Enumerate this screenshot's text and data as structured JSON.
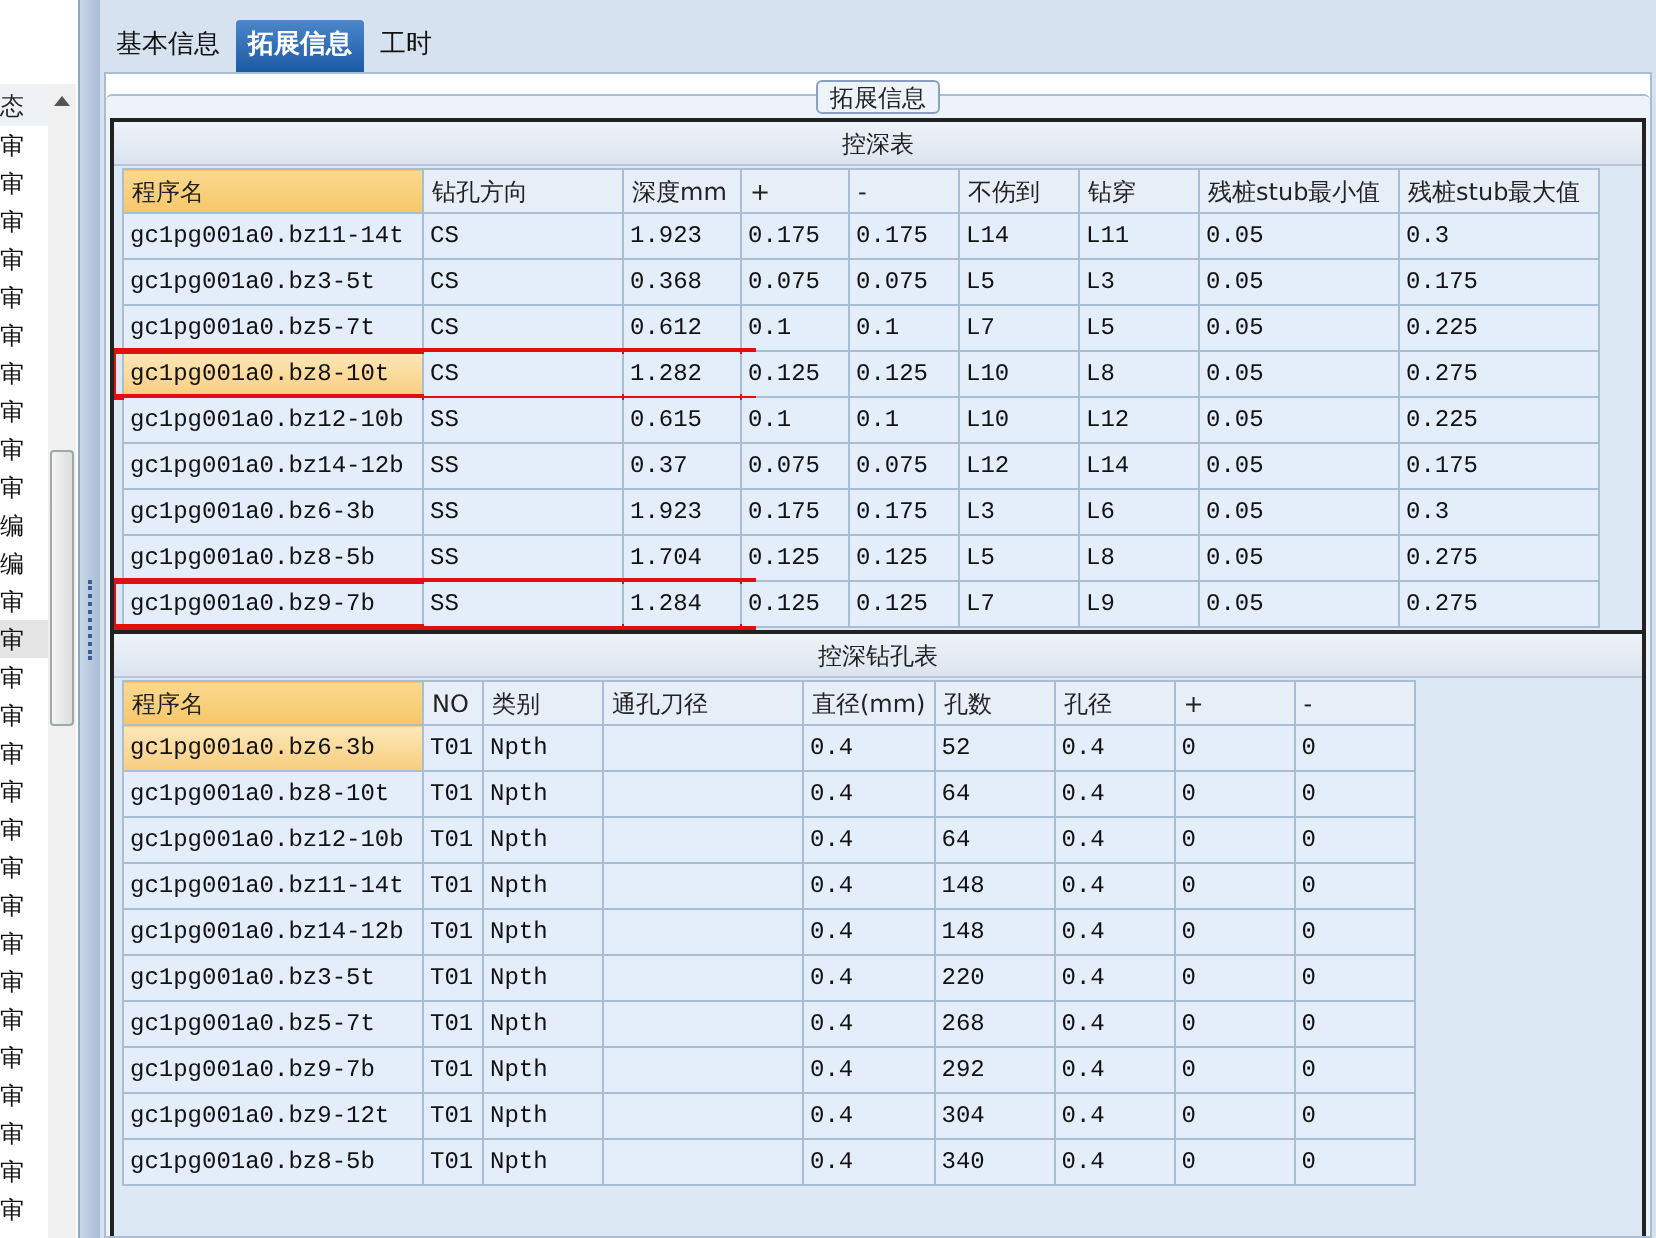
{
  "sidebar": {
    "header": "态",
    "items": [
      {
        "text": "审",
        "selected": false
      },
      {
        "text": "审",
        "selected": false
      },
      {
        "text": "审",
        "selected": false
      },
      {
        "text": "审",
        "selected": false
      },
      {
        "text": "审",
        "selected": false
      },
      {
        "text": "审",
        "selected": false
      },
      {
        "text": "审",
        "selected": false
      },
      {
        "text": "审",
        "selected": false
      },
      {
        "text": "审",
        "selected": false
      },
      {
        "text": "审",
        "selected": false
      },
      {
        "text": "编",
        "selected": false
      },
      {
        "text": "编",
        "selected": false
      },
      {
        "text": "审",
        "selected": false
      },
      {
        "text": "审",
        "selected": true
      },
      {
        "text": "审",
        "selected": false
      },
      {
        "text": "审",
        "selected": false
      },
      {
        "text": "审",
        "selected": false
      },
      {
        "text": "审",
        "selected": false
      },
      {
        "text": "审",
        "selected": false
      },
      {
        "text": "审",
        "selected": false
      },
      {
        "text": "审",
        "selected": false
      },
      {
        "text": "审",
        "selected": false
      },
      {
        "text": "审",
        "selected": false
      },
      {
        "text": "审",
        "selected": false
      },
      {
        "text": "审",
        "selected": false
      },
      {
        "text": "审",
        "selected": false
      },
      {
        "text": "审",
        "selected": false
      },
      {
        "text": "审",
        "selected": false
      },
      {
        "text": "审",
        "selected": false
      }
    ]
  },
  "tabs": [
    {
      "label": "基本信息",
      "selected": false
    },
    {
      "label": "拓展信息",
      "selected": true
    },
    {
      "label": "工时",
      "selected": false
    }
  ],
  "group_title": "拓展信息",
  "tables": [
    {
      "title": "控深表",
      "columns": [
        "程序名",
        "钻孔方向",
        "深度mm",
        "+",
        "-",
        "不伤到",
        "钻穿",
        "残桩stub最小值",
        "残桩stub最大值"
      ],
      "rows": [
        {
          "cells": [
            "gc1pg001a0.bz11-14t",
            "CS",
            "1.923",
            "0.175",
            "0.175",
            "L14",
            "L11",
            "0.05",
            "0.3"
          ],
          "selected": false,
          "highlighted": false
        },
        {
          "cells": [
            "gc1pg001a0.bz3-5t",
            "CS",
            "0.368",
            "0.075",
            "0.075",
            "L5",
            "L3",
            "0.05",
            "0.175"
          ],
          "selected": false,
          "highlighted": false
        },
        {
          "cells": [
            "gc1pg001a0.bz5-7t",
            "CS",
            "0.612",
            "0.1",
            "0.1",
            "L7",
            "L5",
            "0.05",
            "0.225"
          ],
          "selected": false,
          "highlighted": false
        },
        {
          "cells": [
            "gc1pg001a0.bz8-10t",
            "CS",
            "1.282",
            "0.125",
            "0.125",
            "L10",
            "L8",
            "0.05",
            "0.275"
          ],
          "selected": true,
          "highlighted": true
        },
        {
          "cells": [
            "gc1pg001a0.bz12-10b",
            "SS",
            "0.615",
            "0.1",
            "0.1",
            "L10",
            "L12",
            "0.05",
            "0.225"
          ],
          "selected": false,
          "highlighted": false
        },
        {
          "cells": [
            "gc1pg001a0.bz14-12b",
            "SS",
            "0.37",
            "0.075",
            "0.075",
            "L12",
            "L14",
            "0.05",
            "0.175"
          ],
          "selected": false,
          "highlighted": false
        },
        {
          "cells": [
            "gc1pg001a0.bz6-3b",
            "SS",
            "1.923",
            "0.175",
            "0.175",
            "L3",
            "L6",
            "0.05",
            "0.3"
          ],
          "selected": false,
          "highlighted": false
        },
        {
          "cells": [
            "gc1pg001a0.bz8-5b",
            "SS",
            "1.704",
            "0.125",
            "0.125",
            "L5",
            "L8",
            "0.05",
            "0.275"
          ],
          "selected": false,
          "highlighted": false
        },
        {
          "cells": [
            "gc1pg001a0.bz9-7b",
            "SS",
            "1.284",
            "0.125",
            "0.125",
            "L7",
            "L9",
            "0.05",
            "0.275"
          ],
          "selected": false,
          "highlighted": true
        }
      ]
    },
    {
      "title": "控深钻孔表",
      "columns": [
        "程序名",
        "NO",
        "类别",
        "通孔刀径",
        "直径(mm)",
        "孔数",
        "孔径",
        "+",
        "-"
      ],
      "rows": [
        {
          "cells": [
            "gc1pg001a0.bz6-3b",
            "T01",
            "Npth",
            "",
            "0.4",
            "52",
            "0.4",
            "0",
            "0"
          ],
          "selected": true,
          "highlighted": false
        },
        {
          "cells": [
            "gc1pg001a0.bz8-10t",
            "T01",
            "Npth",
            "",
            "0.4",
            "64",
            "0.4",
            "0",
            "0"
          ],
          "selected": false,
          "highlighted": false
        },
        {
          "cells": [
            "gc1pg001a0.bz12-10b",
            "T01",
            "Npth",
            "",
            "0.4",
            "64",
            "0.4",
            "0",
            "0"
          ],
          "selected": false,
          "highlighted": false
        },
        {
          "cells": [
            "gc1pg001a0.bz11-14t",
            "T01",
            "Npth",
            "",
            "0.4",
            "148",
            "0.4",
            "0",
            "0"
          ],
          "selected": false,
          "highlighted": false
        },
        {
          "cells": [
            "gc1pg001a0.bz14-12b",
            "T01",
            "Npth",
            "",
            "0.4",
            "148",
            "0.4",
            "0",
            "0"
          ],
          "selected": false,
          "highlighted": false
        },
        {
          "cells": [
            "gc1pg001a0.bz3-5t",
            "T01",
            "Npth",
            "",
            "0.4",
            "220",
            "0.4",
            "0",
            "0"
          ],
          "selected": false,
          "highlighted": false
        },
        {
          "cells": [
            "gc1pg001a0.bz5-7t",
            "T01",
            "Npth",
            "",
            "0.4",
            "268",
            "0.4",
            "0",
            "0"
          ],
          "selected": false,
          "highlighted": false
        },
        {
          "cells": [
            "gc1pg001a0.bz9-7b",
            "T01",
            "Npth",
            "",
            "0.4",
            "292",
            "0.4",
            "0",
            "0"
          ],
          "selected": false,
          "highlighted": false
        },
        {
          "cells": [
            "gc1pg001a0.bz9-12t",
            "T01",
            "Npth",
            "",
            "0.4",
            "304",
            "0.4",
            "0",
            "0"
          ],
          "selected": false,
          "highlighted": false
        },
        {
          "cells": [
            "gc1pg001a0.bz8-5b",
            "T01",
            "Npth",
            "",
            "0.4",
            "340",
            "0.4",
            "0",
            "0"
          ],
          "selected": false,
          "highlighted": false
        }
      ]
    }
  ]
}
